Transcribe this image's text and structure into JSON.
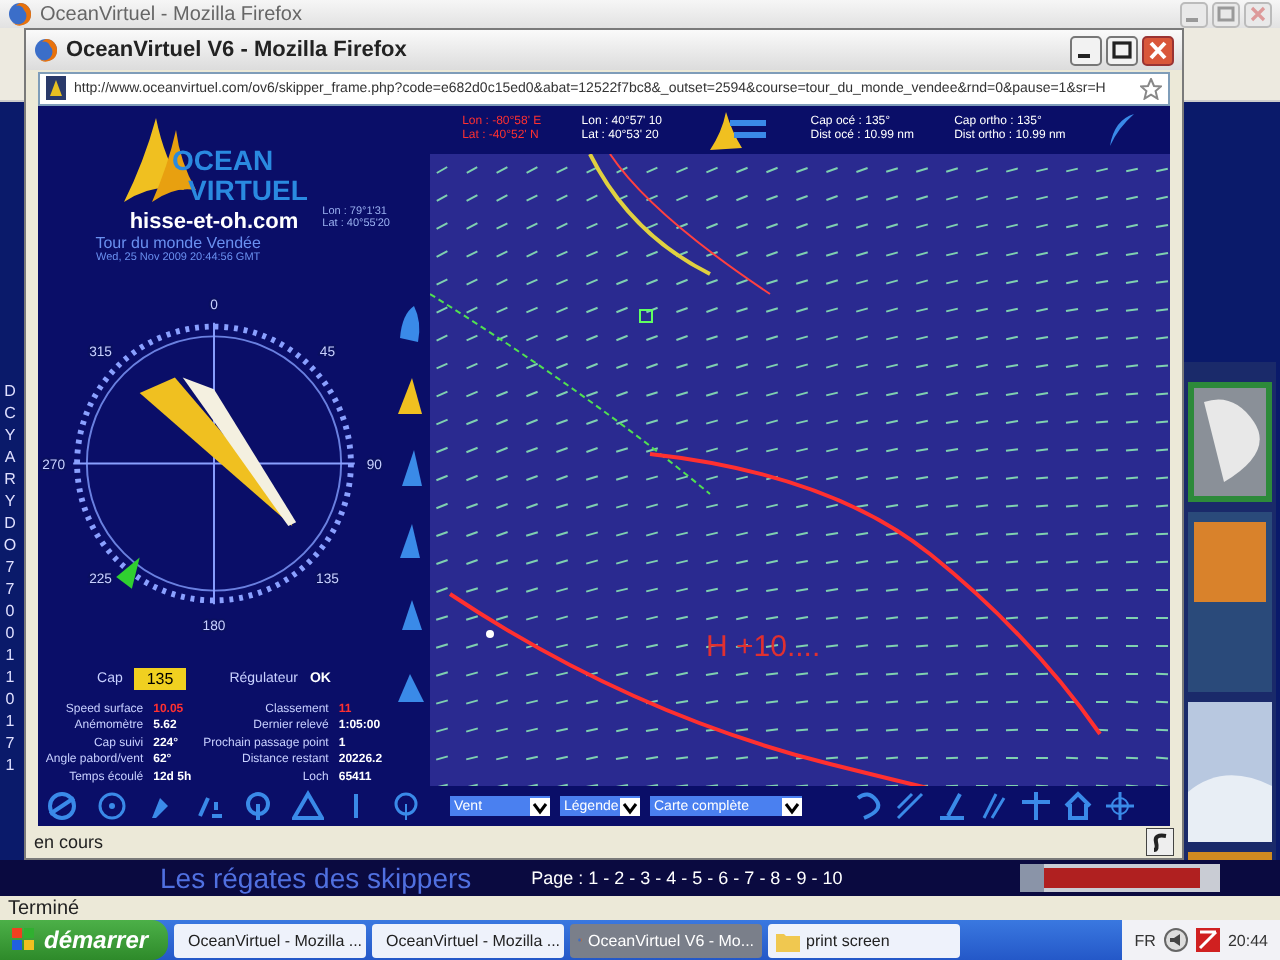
{
  "back_window": {
    "title": "OceanVirtuel - Mozilla Firefox",
    "side_letters": [
      "D",
      "C",
      "Y",
      "A",
      "R",
      "Y",
      "D",
      "O",
      "7",
      "7",
      "0",
      "0",
      "1",
      "1",
      "0",
      "1",
      "7",
      "1"
    ],
    "page_heading": "Les régates des skippers",
    "pager": "Page : 1 - 2 - 3 - 4 - 5 - 6 - 7 - 8 - 9 - 10",
    "status": "Terminé"
  },
  "popup": {
    "title": "OceanVirtuel V6 - Mozilla Firefox",
    "url": "http://www.oceanvirtuel.com/ov6/skipper_frame.php?code=e682d0c15ed0&abat=12522f7bc8&_outset=2594&course=tour_du_monde_vendee&rnd=0&pause=1&sr=H",
    "header": [
      {
        "lines": [
          "Lon : -80°58' E",
          "Lat : -40°52' N"
        ],
        "color": "#ff3030"
      },
      {
        "lines": [
          "Lon : 40°57' 10",
          "Lat : 40°53' 20"
        ],
        "color": "#ffffff"
      },
      {
        "lines": [
          "Cap océ : 135°",
          "Dist océ : 10.99 nm"
        ],
        "color": "#ffffff"
      },
      {
        "lines": [
          "Cap ortho : 135°",
          "Dist ortho : 10.99 nm"
        ],
        "color": "#ffffff"
      }
    ],
    "logo": [
      "OCEAN",
      "VIRTUEL"
    ],
    "site": "hisse-et-oh.com",
    "race": "Tour du monde Vendée",
    "date": "Wed, 25 Nov 2009 20:44:56 GMT",
    "position": [
      "Lon : 79°1'31",
      "Lat : 40°55'20"
    ],
    "compass_labels": [
      "0",
      "45",
      "90",
      "135",
      "180",
      "225",
      "270",
      "315"
    ],
    "sails": [
      {
        "selected": false
      },
      {
        "selected": true
      },
      {
        "selected": false
      },
      {
        "selected": false
      },
      {
        "selected": false
      },
      {
        "selected": false
      }
    ],
    "cap_label": "Cap",
    "cap_value": "135",
    "regulator_label": "Régulateur",
    "regulator_value": "OK",
    "stats_left": [
      {
        "label": "Speed surface",
        "value": "10.05",
        "color": "#ff3030"
      },
      {
        "label": "Anémomètre",
        "value": "5.62",
        "color": "#ffffff"
      },
      {
        "label": "Cap suivi",
        "value": "224°",
        "color": "#ffffff"
      },
      {
        "label": "Angle pabord/vent",
        "value": "62°",
        "color": "#ffffff"
      },
      {
        "label": "Temps écoulé",
        "value": "12d 5h",
        "color": "#ffffff"
      }
    ],
    "stats_right": [
      {
        "label": "Classement",
        "value": "11",
        "color": "#ff3030"
      },
      {
        "label": "Dernier relevé",
        "value": "1:05:00",
        "color": "#ffffff"
      },
      {
        "label": "Prochain passage point",
        "value": "1",
        "color": "#ffffff"
      },
      {
        "label": "Distance restant",
        "value": "20226.2",
        "color": "#ffffff"
      },
      {
        "label": "Loch",
        "value": "65411",
        "color": "#ffffff"
      }
    ],
    "map_label": "H +10....",
    "selects": [
      "Vent",
      "Légende",
      "Carte complète"
    ],
    "status": "en cours"
  },
  "taskbar": {
    "start": "démarrer",
    "tasks": [
      {
        "label": "OceanVirtuel - Mozilla ...",
        "kind": "browser",
        "selected": false
      },
      {
        "label": "OceanVirtuel - Mozilla ...",
        "kind": "browser",
        "selected": false
      },
      {
        "label": "OceanVirtuel V6 - Mo...",
        "kind": "browser",
        "selected": true
      },
      {
        "label": "print screen",
        "kind": "folder",
        "selected": false
      }
    ],
    "lang": "FR",
    "clock": "20:44"
  }
}
